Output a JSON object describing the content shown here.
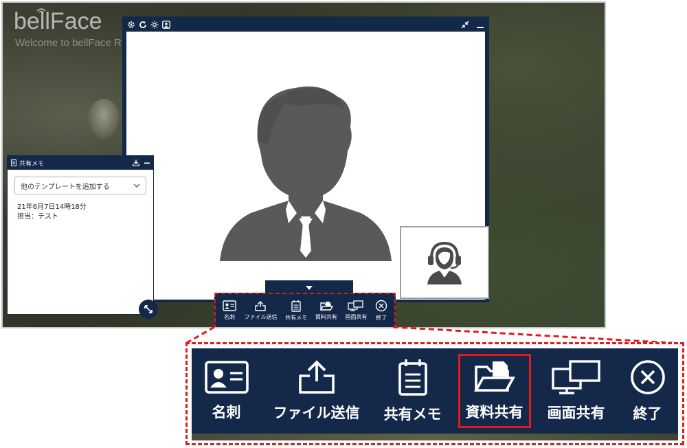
{
  "app": {
    "brand": "bellFace",
    "welcome": "Welcome to bellFace R"
  },
  "memo": {
    "title": "共有メモ",
    "template_placeholder": "他のテンプレートを追加する",
    "lines": [
      "21年6月7日14時18分",
      "担当：テスト"
    ]
  },
  "toolbar": {
    "items": [
      {
        "label": "名刺",
        "icon": "business-card-icon"
      },
      {
        "label": "ファイル送信",
        "icon": "file-upload-icon"
      },
      {
        "label": "共有メモ",
        "icon": "memo-icon"
      },
      {
        "label": "資料共有",
        "icon": "document-share-icon"
      },
      {
        "label": "画面共有",
        "icon": "screen-share-icon"
      },
      {
        "label": "終了",
        "icon": "close-circle-icon"
      }
    ],
    "highlighted": "資料共有"
  },
  "colors": {
    "navy": "#142849",
    "highlight_red": "#e01b1b",
    "silhouette": "#595959"
  }
}
